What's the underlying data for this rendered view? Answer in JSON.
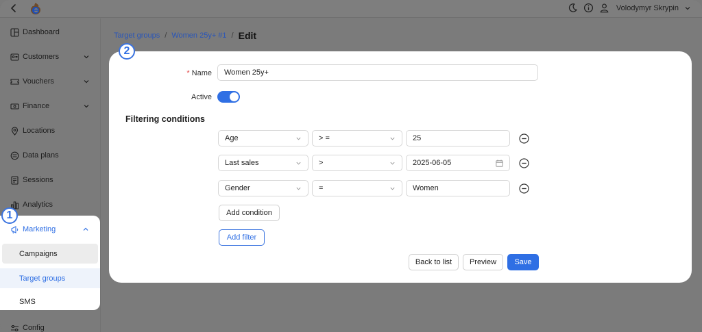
{
  "topbar": {
    "user_name": "Volodymyr Skrypin",
    "icons": [
      "back-icon",
      "app-logo-icon",
      "moon-icon",
      "info-icon",
      "user-icon",
      "chevron-down-icon"
    ]
  },
  "sidebar": {
    "items": [
      {
        "label": "Dashboard",
        "icon": "dashboard-icon"
      },
      {
        "label": "Customers",
        "icon": "customers-icon",
        "expandable": true
      },
      {
        "label": "Vouchers",
        "icon": "voucher-icon",
        "expandable": true
      },
      {
        "label": "Finance",
        "icon": "finance-icon",
        "expandable": true
      },
      {
        "label": "Locations",
        "icon": "location-icon"
      },
      {
        "label": "Data plans",
        "icon": "data-plans-icon"
      },
      {
        "label": "Sessions",
        "icon": "sessions-icon"
      },
      {
        "label": "Analytics",
        "icon": "analytics-icon"
      }
    ],
    "marketing": {
      "label": "Marketing",
      "children": [
        "Campaigns",
        "Target groups",
        "SMS"
      ],
      "active_child": "Target groups"
    },
    "config_label": "Config"
  },
  "badges": [
    "1",
    "2"
  ],
  "breadcrumb": {
    "link1": "Target groups",
    "sep": "/",
    "link2": "Women 25y+ #1",
    "current": "Edit"
  },
  "form": {
    "name_label": "Name",
    "name_required_mark": "*",
    "name_value": "Women 25y+",
    "active_label": "Active",
    "active": true,
    "section_title": "Filtering conditions",
    "conditions": [
      {
        "field": "Age",
        "operator": "> =",
        "value": "25"
      },
      {
        "field": "Last sales",
        "operator": ">",
        "value": "2025-06-05"
      },
      {
        "field": "Gender",
        "operator": "=",
        "value": "Women"
      }
    ],
    "add_condition_label": "Add condition",
    "add_filter_label": "Add filter"
  },
  "actions": {
    "back_label": "Back to list",
    "preview_label": "Preview",
    "save_label": "Save"
  },
  "colors": {
    "accent": "#2f6fe4",
    "overlay": "#7b7b7b",
    "required": "#e34b4b"
  }
}
